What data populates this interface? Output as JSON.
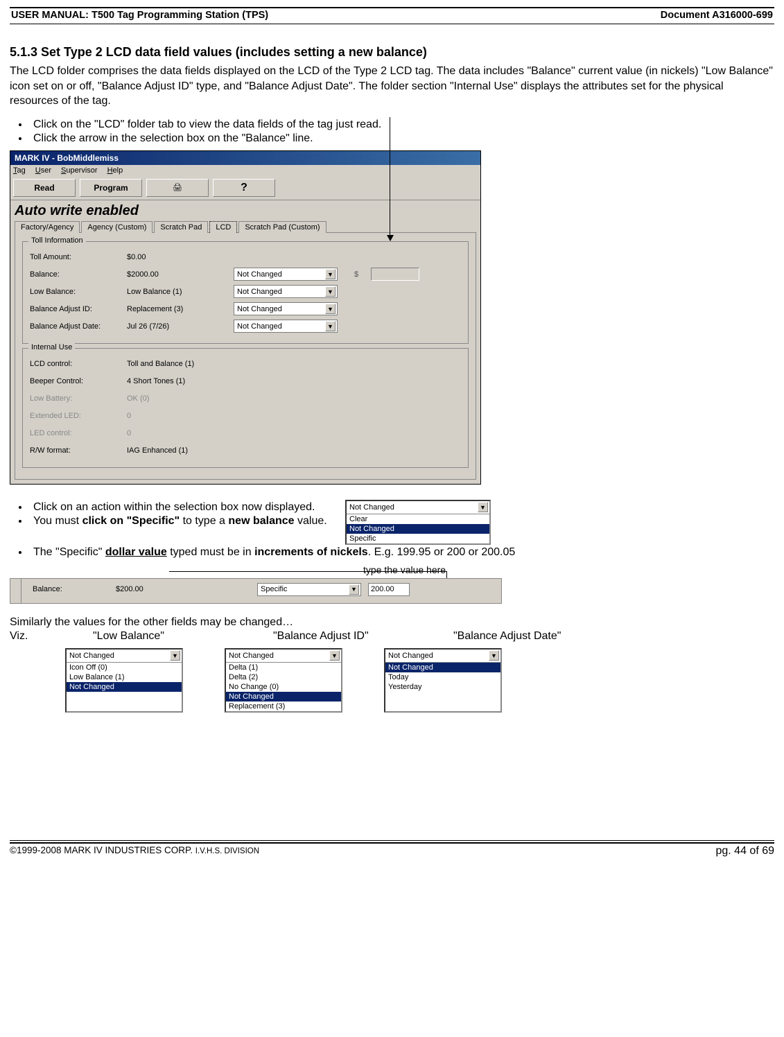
{
  "header": {
    "left": "USER MANUAL: T500 Tag Programming Station (TPS)",
    "right": "Document A316000-699"
  },
  "section": {
    "heading": "5.1.3 Set Type 2 LCD data field values (includes setting a new balance)",
    "intro": "The LCD folder comprises the data fields displayed on the LCD of the Type 2 LCD tag. The data includes \"Balance\" current value (in nickels) \"Low Balance\" icon set on or off, \"Balance Adjust ID\" type, and \"Balance Adjust Date\". The folder section \"Internal Use\" displays the attributes set for the physical resources of the tag.",
    "bullets_a": [
      "Click on the \"LCD\" folder tab to view the data fields of the tag just read.",
      "Click the arrow in the selection box on the \"Balance\" line."
    ],
    "bullets_b": {
      "b1": "Click on an action within the selection box now displayed.",
      "b2_pre": "You must ",
      "b2_bold1": "click on \"Specific\"",
      "b2_mid": " to type a ",
      "b2_bold2": "new balance",
      "b2_post": " value.",
      "b3_pre": "The \"Specific\" ",
      "b3_bold1": "dollar value",
      "b3_mid": " typed must be in ",
      "b3_bold2": "increments of nickels",
      "b3_post": ". E.g. 199.95 or 200 or 200.05"
    },
    "type_here_label": "type the value here",
    "similarly": "Similarly the values for the other fields may be changed…",
    "viz_label": "Viz.",
    "viz_cols": [
      "\"Low Balance\"",
      "\"Balance Adjust ID\"",
      "\"Balance Adjust Date\""
    ]
  },
  "app": {
    "title": "MARK IV - BobMiddlemiss",
    "menus": [
      "Tag",
      "User",
      "Supervisor",
      "Help"
    ],
    "toolbar": {
      "read": "Read",
      "program": "Program"
    },
    "auto_write": "Auto write enabled",
    "tabs": [
      "Factory/Agency",
      "Agency (Custom)",
      "Scratch Pad",
      "LCD",
      "Scratch Pad (Custom)"
    ],
    "active_tab": "LCD",
    "toll_group_title": "Toll Information",
    "internal_group_title": "Internal Use",
    "combo_default": "Not Changed",
    "toll_rows": [
      {
        "label": "Toll Amount:",
        "value": "$0.00",
        "combo": false
      },
      {
        "label": "Balance:",
        "value": "$2000.00",
        "combo": true,
        "extra_dollar": true
      },
      {
        "label": "Low Balance:",
        "value": "Low Balance (1)",
        "combo": true
      },
      {
        "label": "Balance Adjust ID:",
        "value": "Replacement (3)",
        "combo": true
      },
      {
        "label": "Balance Adjust Date:",
        "value": "Jul 26 (7/26)",
        "combo": true
      }
    ],
    "internal_rows": [
      {
        "label": "LCD control:",
        "value": "Toll and Balance (1)",
        "dim": false
      },
      {
        "label": "Beeper Control:",
        "value": "4 Short Tones (1)",
        "dim": false
      },
      {
        "label": "Low Battery:",
        "value": "OK (0)",
        "dim": true
      },
      {
        "label": "Extended LED:",
        "value": "0",
        "dim": true
      },
      {
        "label": "LED control:",
        "value": "0",
        "dim": true
      },
      {
        "label": "R/W format:",
        "value": "IAG Enhanced (1)",
        "dim": false
      }
    ]
  },
  "dd_action": {
    "top": "Not Changed",
    "options": [
      "Clear",
      "Not Changed",
      "Specific"
    ],
    "selected": "Not Changed"
  },
  "balance_strip": {
    "label": "Balance:",
    "value": "$200.00",
    "combo": "Specific",
    "typed": "200.00"
  },
  "dd_low_balance": {
    "top": "Not Changed",
    "options": [
      "Icon Off (0)",
      "Low Balance (1)",
      "Not Changed"
    ],
    "selected": "Not Changed"
  },
  "dd_adjust_id": {
    "top": "Not Changed",
    "options": [
      "Delta (1)",
      "Delta (2)",
      "No Change (0)",
      "Not Changed",
      "Replacement (3)"
    ],
    "selected": "Not Changed"
  },
  "dd_adjust_date": {
    "top": "Not Changed",
    "options": [
      "Not Changed",
      "Today",
      "Yesterday"
    ],
    "selected": "Not Changed"
  },
  "footer": {
    "copyright_a": "©1999-2008 MARK IV INDUSTRIES CORP. ",
    "copyright_b": "I.V.H.S. DIVISION",
    "page": "pg. 44 of 69"
  }
}
